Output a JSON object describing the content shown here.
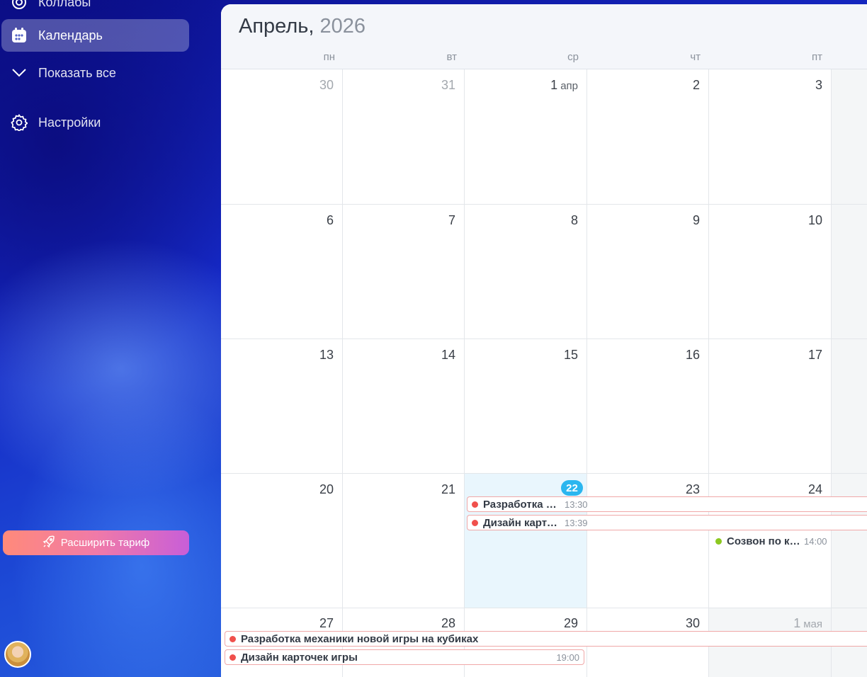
{
  "sidebar": {
    "top_item_partial": "Коллабы",
    "calendar_label": "Календарь",
    "show_all_label": "Показать все",
    "settings_label": "Настройки",
    "upgrade_label": "Расширить тариф"
  },
  "calendar": {
    "month": "Апрель,",
    "year": "2026",
    "weekdays": [
      "пн",
      "вт",
      "ср",
      "чт",
      "пт"
    ],
    "weeks": [
      [
        "30",
        "31",
        "1",
        "2",
        "3"
      ],
      [
        "6",
        "7",
        "8",
        "9",
        "10"
      ],
      [
        "13",
        "14",
        "15",
        "16",
        "17"
      ],
      [
        "20",
        "21",
        "22",
        "23",
        "24"
      ],
      [
        "27",
        "28",
        "29",
        "30",
        "1"
      ]
    ],
    "apr_abbr": "апр",
    "may_abbr": "мая",
    "today": "22",
    "events": [
      {
        "title": "Разработка м...",
        "time": "13:30",
        "color": "#f0504c"
      },
      {
        "title": "Дизайн карто...",
        "time": "13:39",
        "color": "#f0504c"
      },
      {
        "title": "Созвон по ку...",
        "time": "14:00",
        "color": "#8cc820"
      },
      {
        "title": "Разработка механики новой игры на кубиках",
        "time": "",
        "color": "#f0504c"
      },
      {
        "title": "Дизайн карточек игры",
        "time": "19:00",
        "color": "#f0504c"
      }
    ]
  },
  "colors": {
    "accent": "#2bb6ef",
    "event_red": "#f0504c",
    "event_green": "#8cc820"
  }
}
